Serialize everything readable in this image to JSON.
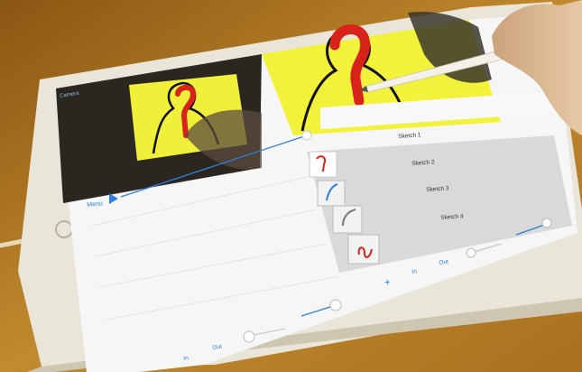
{
  "app": {
    "back_label": "Camera",
    "menu_label": "Menu"
  },
  "sketch_list": {
    "items": [
      {
        "label": "Sketch 1"
      },
      {
        "label": "Sketch 2"
      },
      {
        "label": "Sketch 3"
      },
      {
        "label": "Sketch 4"
      }
    ]
  },
  "toolbar_left": {
    "in_label": "In",
    "out_label": "Out"
  },
  "toolbar_right": {
    "add_label": "+",
    "in_label": "In",
    "out_label": "Out"
  },
  "colors": {
    "desk": "#b87a1f",
    "ipad_frame": "#e9e4d8",
    "screen_bg": "#f7f7f7",
    "accent": "#2f7fe0",
    "sketch_yellow": "#f2f23a",
    "sketch_red": "#d8231a",
    "selected_row": "#d9d9d9"
  }
}
